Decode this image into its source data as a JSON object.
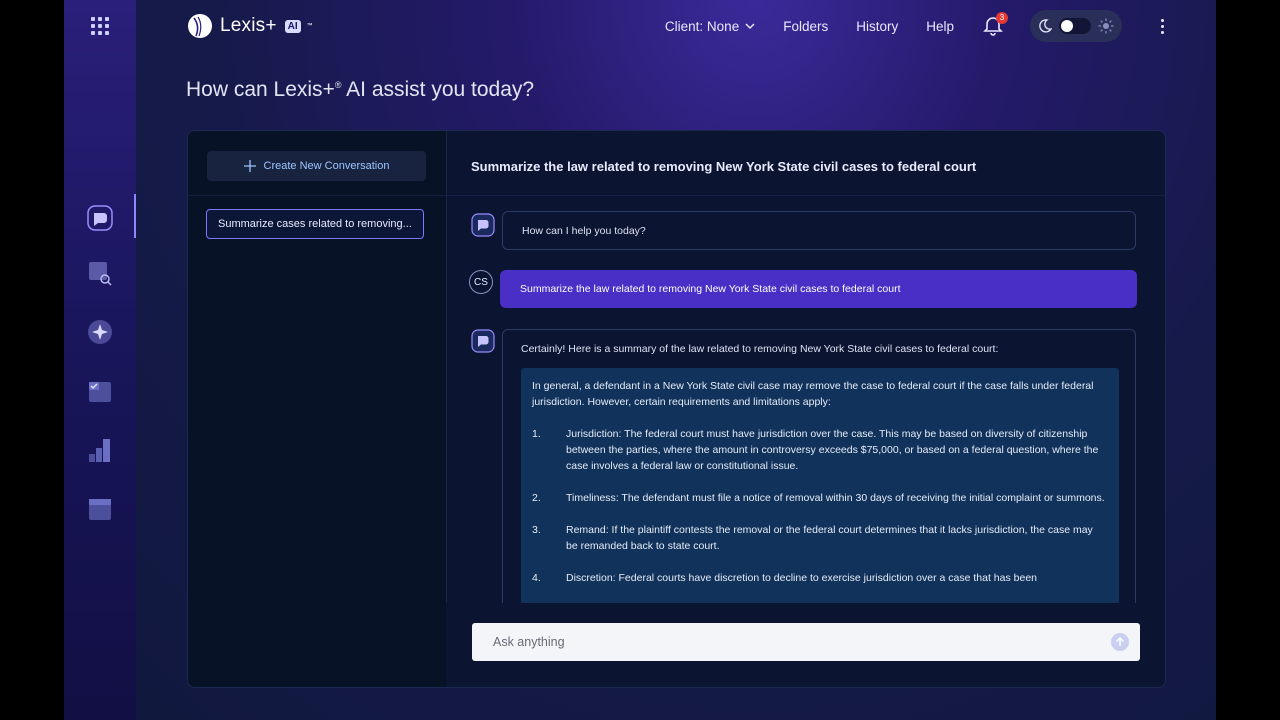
{
  "app": {
    "logo_text": "Lexis+",
    "logo_badge": "AI",
    "logo_tm": "™"
  },
  "nav": {
    "client_label": "Client: None",
    "folders": "Folders",
    "history": "History",
    "help": "Help",
    "notification_count": "3"
  },
  "greeting": {
    "pre": "How can Lexis+",
    "reg": "®",
    "post": " AI assist you today?"
  },
  "sidebar": {
    "new_conversation": "Create New Conversation",
    "conversations": [
      {
        "label": "Summarize cases related to removing..."
      }
    ]
  },
  "chat": {
    "title": "Summarize the law related to removing New York State civil cases to federal court",
    "bot_greeting": "How can I help you today?",
    "user_initials": "CS",
    "user_message": "Summarize the law related to removing New York State civil cases to federal court",
    "bot_intro": "Certainly! Here is a summary of the law related to removing New York State civil cases to federal court:",
    "answer_intro": "In general, a defendant in a New York State civil case may remove the case to federal court if the case falls under federal jurisdiction. However, certain requirements and limitations apply:",
    "points": [
      {
        "num": "1.",
        "text": "Jurisdiction: The federal court must have jurisdiction over the case. This may be based on diversity of citizenship between the parties, where the amount in controversy exceeds $75,000, or based on a federal question, where the case involves a federal law or constitutional issue."
      },
      {
        "num": "2.",
        "text": "Timeliness: The defendant must file a notice of removal within 30 days of receiving the initial complaint or summons."
      },
      {
        "num": "3.",
        "text": "Remand: If the plaintiff contests the removal or the federal court determines that it lacks jurisdiction, the case may be remanded back to state court."
      },
      {
        "num": "4.",
        "text": "Discretion: Federal courts have discretion to decline to exercise jurisdiction over a case that has been"
      }
    ]
  },
  "input": {
    "placeholder": "Ask anything"
  },
  "colors": {
    "accent": "#4a2fc7",
    "active_outline": "#7c78ff",
    "notification": "#e53935"
  }
}
